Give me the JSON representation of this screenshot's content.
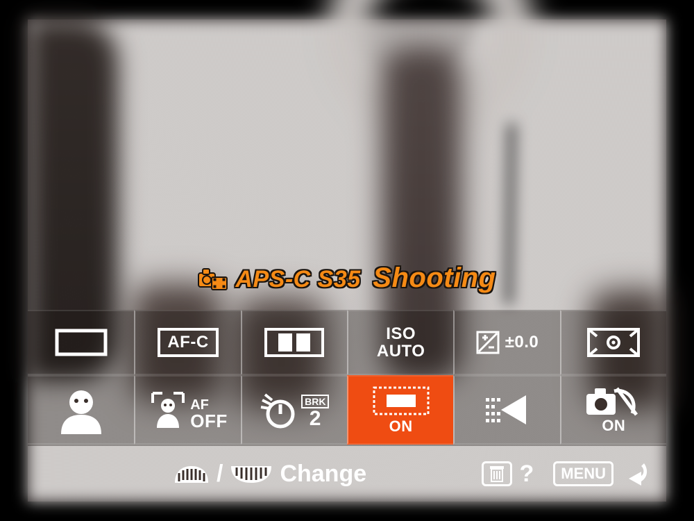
{
  "colors": {
    "accent": "#f58a15",
    "selected_bg": "#ef4c12",
    "fg": "#ffffff"
  },
  "setting_title": {
    "line1": "APS-C S35",
    "line2_italic": "Shooting"
  },
  "grid": {
    "row1": [
      {
        "id": "drive-mode",
        "kind": "icon"
      },
      {
        "id": "focus-mode",
        "kind": "text",
        "text": "AF-C"
      },
      {
        "id": "focus-area",
        "kind": "icon"
      },
      {
        "id": "iso",
        "kind": "text2",
        "top": "ISO",
        "bottom": "AUTO"
      },
      {
        "id": "exposure-comp",
        "kind": "ev",
        "value": "±0.0"
      },
      {
        "id": "metering-mode",
        "kind": "icon"
      }
    ],
    "row2": [
      {
        "id": "face-priority",
        "kind": "icon"
      },
      {
        "id": "face-af",
        "kind": "faceaf",
        "top": "AF",
        "bottom": "OFF"
      },
      {
        "id": "self-timer-bracket",
        "kind": "timer",
        "brk": "BRK",
        "count": "2"
      },
      {
        "id": "apsc-s35",
        "kind": "apsc",
        "state": "ON",
        "selected": true
      },
      {
        "id": "peaking",
        "kind": "icon"
      },
      {
        "id": "touch-shutter",
        "kind": "touch",
        "state": "ON"
      }
    ]
  },
  "footer": {
    "change_label": "Change",
    "help_symbol": "?",
    "menu_label": "MENU"
  }
}
